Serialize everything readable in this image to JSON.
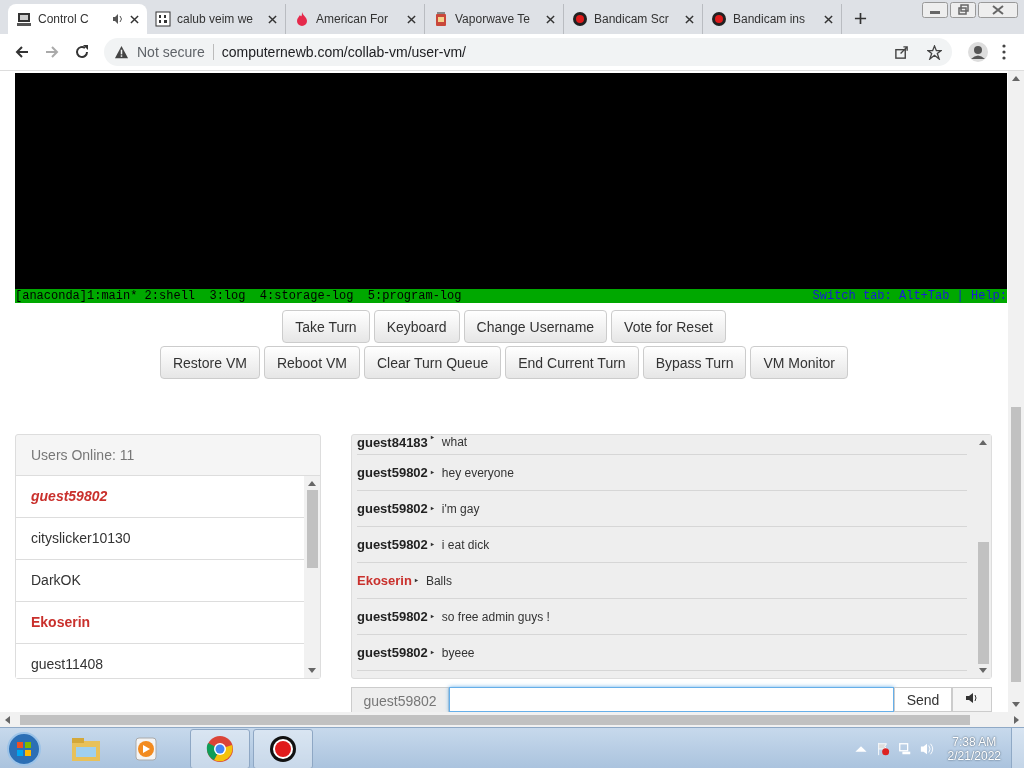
{
  "browser": {
    "tabs": [
      {
        "title": "Control C",
        "selected": true,
        "audio": true
      },
      {
        "title": "calub veim we",
        "selected": false,
        "audio": false
      },
      {
        "title": "American For",
        "selected": false,
        "audio": false
      },
      {
        "title": "Vaporwave Te",
        "selected": false,
        "audio": false
      },
      {
        "title": "Bandicam Scr",
        "selected": false,
        "audio": false
      },
      {
        "title": "Bandicam ins",
        "selected": false,
        "audio": false
      }
    ],
    "security": "Not secure",
    "url": "computernewb.com/collab-vm/user-vm/"
  },
  "vm": {
    "status_left": "[anaconda]1:main* 2:shell  3:log  4:storage-log  5:program-log",
    "status_right": "Switch tab: Alt+Tab | Help:"
  },
  "button_rows": [
    [
      "Take Turn",
      "Keyboard",
      "Change Username",
      "Vote for Reset"
    ],
    [
      "Restore VM",
      "Reboot VM",
      "Clear Turn Queue",
      "End Current Turn",
      "Bypass Turn",
      "VM Monitor"
    ]
  ],
  "users": {
    "header": "Users Online: 11",
    "items": [
      {
        "name": "guest59802",
        "kind": "self"
      },
      {
        "name": "cityslicker10130",
        "kind": "normal"
      },
      {
        "name": "DarkOK",
        "kind": "normal"
      },
      {
        "name": "Ekoserin",
        "kind": "admin"
      },
      {
        "name": "guest11408",
        "kind": "normal"
      }
    ]
  },
  "chat": {
    "messages": [
      {
        "user": "guest84183",
        "text": "what",
        "kind": "normal"
      },
      {
        "user": "guest59802",
        "text": "hey everyone",
        "kind": "normal"
      },
      {
        "user": "guest59802",
        "text": "i'm gay",
        "kind": "normal"
      },
      {
        "user": "guest59802",
        "text": "i eat dick",
        "kind": "normal"
      },
      {
        "user": "Ekoserin",
        "text": "Balls",
        "kind": "admin"
      },
      {
        "user": "guest59802",
        "text": "so free admin guys !",
        "kind": "normal"
      },
      {
        "user": "guest59802",
        "text": "byeee",
        "kind": "normal"
      }
    ],
    "username": "guest59802",
    "send": "Send"
  },
  "taskbar": {
    "time": "7:38 AM",
    "date": "2/21/2022"
  }
}
